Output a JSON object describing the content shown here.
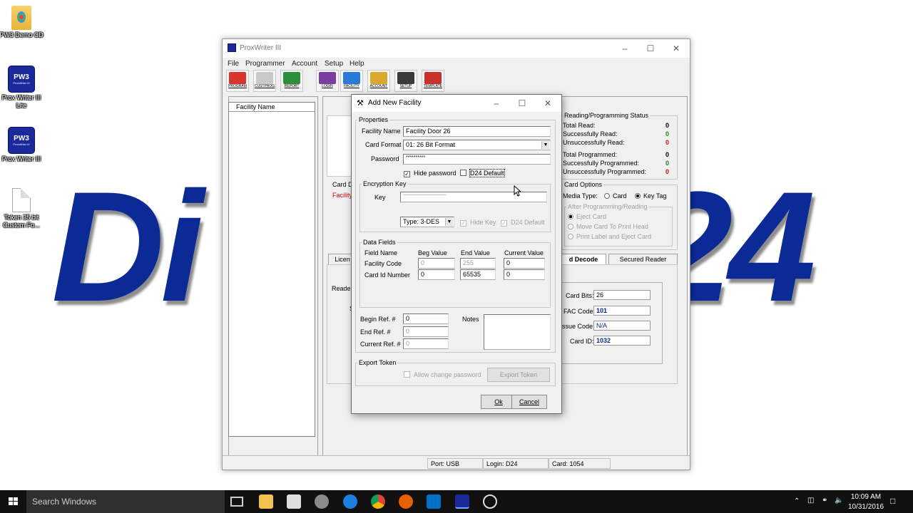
{
  "wallpaper": {
    "left_text": "Di",
    "right_text": "24",
    "color": "#0b2a96"
  },
  "desktop_icons": [
    {
      "label": "PW3 Demo CD",
      "type": "folder"
    },
    {
      "label": "Prox Writer III Lite",
      "type": "app",
      "badge": "PW3"
    },
    {
      "label": "Prox Writer III",
      "type": "app",
      "badge": "PW3"
    },
    {
      "label": "Token 35 bit Custom Fo...",
      "type": "file"
    }
  ],
  "main_window": {
    "title": "ProxWriter III",
    "menu": [
      "File",
      "Programmer",
      "Account",
      "Setup",
      "Help"
    ],
    "toolbar": [
      {
        "label": "PROGRAM",
        "color": "#d9352c"
      },
      {
        "label": "CUSTPROG",
        "color": "#d9352c"
      },
      {
        "label": "REPORT",
        "color": "#2d8f3a"
      },
      {
        "label": "LOGIN",
        "color": "#7a3ea0"
      },
      {
        "label": "FACILITY",
        "color": "#2a7bd8"
      },
      {
        "label": "ACCOUNT",
        "color": "#d9a82c"
      },
      {
        "label": "SETUP",
        "color": "#3a3a3a"
      },
      {
        "label": "TEMPLATE",
        "color": "#c8322a"
      }
    ],
    "facility_list_header": "Facility Name",
    "left_partial": {
      "card_d": "Card D",
      "facility": "Facility",
      "licen": "Licen",
      "reader": "Reader",
      "s": "S"
    },
    "status": {
      "title": "Reading/Programming Status",
      "rows": [
        {
          "label": "Total Read:",
          "value": "0",
          "color": "#000000"
        },
        {
          "label": "Successfully Read:",
          "value": "0",
          "color": "#1a8a1a"
        },
        {
          "label": "Unsuccessfully Read:",
          "value": "0",
          "color": "#d01010"
        },
        {
          "label": "Total Programmed:",
          "value": "0",
          "color": "#000000"
        },
        {
          "label": "Successfully Programmed:",
          "value": "0",
          "color": "#1a8a1a"
        },
        {
          "label": "Unsuccessfully Programmed:",
          "value": "0",
          "color": "#d01010"
        }
      ]
    },
    "card_options": {
      "title": "Card Options",
      "media_type_label": "Media Type:",
      "media_card": "Card",
      "media_keytag": "Key Tag",
      "after_title": "After Programming/Reading",
      "after_options": [
        "Eject Card",
        "Move Card To Print Head",
        "Print Label and Eject Card"
      ]
    },
    "tabs": [
      "d Decode",
      "Secured Reader"
    ],
    "decode": [
      {
        "label": "Card Bits:",
        "value": "26",
        "bold": false
      },
      {
        "label": "FAC Code:",
        "value": "101",
        "bold": true
      },
      {
        "label": "ssue Code:",
        "value": "N/A",
        "bold": false
      },
      {
        "label": "Card ID:",
        "value": "1032",
        "bold": true
      }
    ],
    "statusbar": {
      "port": "Port: USB",
      "login": "Login: D24",
      "card": "Card: 1054"
    }
  },
  "dialog": {
    "title": "Add New Facility",
    "properties_title": "Properties",
    "facility_name_label": "Facility Name",
    "facility_name_value": "Facility Door 26",
    "card_format_label": "Card Format",
    "card_format_value": "01: 26 Bit Format",
    "password_label": "Password",
    "password_value": "**********",
    "hide_password_label": "Hide password",
    "d24_default_label": "D24 Default",
    "encryption_title": "Encryption Key",
    "key_label": "Key",
    "key_value": "------------------------------------------------------------",
    "type_value": "Type: 3-DES",
    "hide_key_label": "Hide Key",
    "d24_default2_label": "D24 Default",
    "data_fields_title": "Data Fields",
    "columns": [
      "Field Name",
      "Beg Value",
      "End Value",
      "Current Value"
    ],
    "rows": [
      {
        "name": "Facility Code",
        "beg": "0",
        "end": "255",
        "current": "0"
      },
      {
        "name": "Card Id Number",
        "beg": "0",
        "end": "65535",
        "current": "0"
      }
    ],
    "begin_ref_label": "Begin Ref. #",
    "begin_ref_value": "0",
    "end_ref_label": "End Ref. #",
    "end_ref_value": "0",
    "current_ref_label": "Current Ref. #",
    "current_ref_value": "0",
    "notes_label": "Notes",
    "export_title": "Export Token",
    "allow_change_label": "Allow change password",
    "export_button": "Export Token",
    "ok_button": "Ok",
    "cancel_button": "Cancel"
  },
  "taskbar": {
    "search_placeholder": "Search Windows",
    "time": "10:09 AM",
    "date": "10/31/2016"
  }
}
